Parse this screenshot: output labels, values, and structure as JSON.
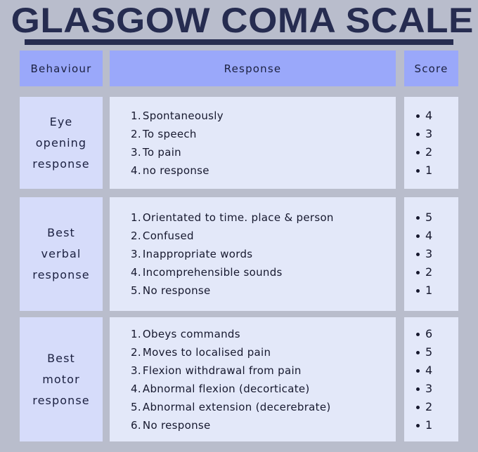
{
  "page": {
    "title": "GLASGOW COMA SCALE",
    "background_color": "#b9bdcc",
    "title_color": "#262c50",
    "header_cell_color": "#9aa8fa",
    "behaviour_cell_color": "#d6dcfa",
    "response_cell_color": "#e3e8f9"
  },
  "header": {
    "behaviour": "Behaviour",
    "response": "Response",
    "score": "Score"
  },
  "rows": [
    {
      "behaviour": "Eye\nopening\nresponse",
      "behaviour_lines": [
        "Eye",
        "opening",
        "response"
      ],
      "responses": [
        {
          "num": "1.",
          "text": "Spontaneously"
        },
        {
          "num": "2.",
          "text": "To speech"
        },
        {
          "num": "3.",
          "text": "To pain"
        },
        {
          "num": "4.",
          "text": "no response"
        }
      ],
      "scores": [
        "4",
        "3",
        "2",
        "1"
      ]
    },
    {
      "behaviour": "Best\nverbal\nresponse",
      "behaviour_lines": [
        "Best",
        "verbal",
        "response"
      ],
      "responses": [
        {
          "num": "1.",
          "text": "Orientated to time. place & person"
        },
        {
          "num": "2.",
          "text": "Confused"
        },
        {
          "num": "3.",
          "text": "Inappropriate words"
        },
        {
          "num": "4.",
          "text": "Incomprehensible sounds"
        },
        {
          "num": "5.",
          "text": "No response"
        }
      ],
      "scores": [
        "5",
        "4",
        "3",
        "2",
        "1"
      ]
    },
    {
      "behaviour": "Best\nmotor\nresponse",
      "behaviour_lines": [
        "Best",
        "motor",
        "response"
      ],
      "responses": [
        {
          "num": "1.",
          "text": "Obeys commands"
        },
        {
          "num": "2.",
          "text": "Moves to localised pain"
        },
        {
          "num": "3.",
          "text": "Flexion withdrawal from pain"
        },
        {
          "num": "4.",
          "text": "Abnormal flexion (decorticate)"
        },
        {
          "num": "5.",
          "text": "Abnormal extension (decerebrate)"
        },
        {
          "num": "6.",
          "text": "No response"
        }
      ],
      "scores": [
        "6",
        "5",
        "4",
        "3",
        "2",
        "1"
      ]
    }
  ]
}
